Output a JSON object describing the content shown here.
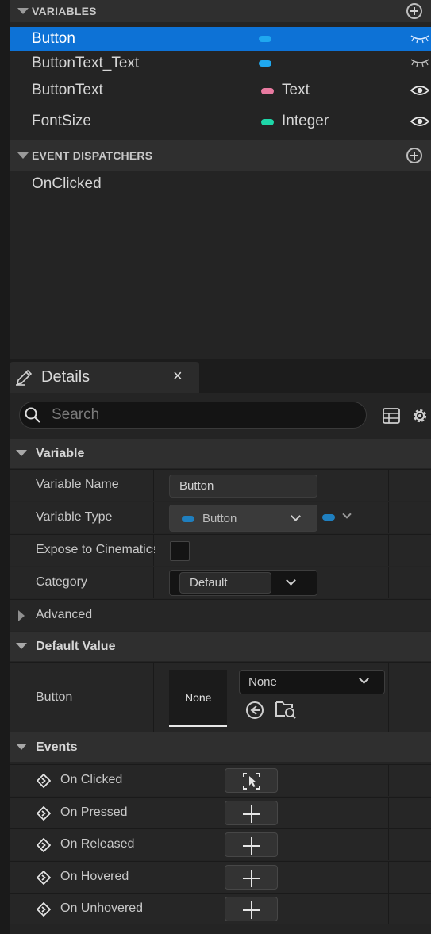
{
  "my_blueprint": {
    "variables_header": "VARIABLES",
    "variables": [
      {
        "name": "Button",
        "type": "",
        "color": "#1fa8f0",
        "selected": true
      },
      {
        "name": "ButtonText_Text",
        "type": "",
        "color": "#1fa8f0",
        "selected": false
      },
      {
        "name": "ButtonText",
        "type": "Text",
        "color": "#e87aa0",
        "selected": false
      },
      {
        "name": "FontSize",
        "type": "Integer",
        "color": "#1ed6a8",
        "selected": false
      }
    ],
    "dispatchers_header": "EVENT DISPATCHERS",
    "dispatchers": [
      {
        "name": "OnClicked"
      }
    ]
  },
  "details": {
    "tab_title": "Details",
    "close_glyph": "×",
    "search_placeholder": "Search",
    "variable_section": {
      "label": "Variable",
      "name_label": "Variable Name",
      "name_value": "Button",
      "type_label": "Variable Type",
      "type_value": "Button",
      "type_color": "#1f7fbf",
      "expose_label": "Expose to Cinematics",
      "category_label": "Category",
      "category_value": "Default",
      "advanced_label": "Advanced"
    },
    "default_value_section": {
      "label": "Default Value",
      "prop_label": "Button",
      "thumbnail_text": "None",
      "asset_value": "None"
    },
    "events_section": {
      "label": "Events",
      "events": [
        "On Clicked",
        "On Pressed",
        "On Released",
        "On Hovered",
        "On Unhovered"
      ]
    }
  },
  "icons": {
    "add_variable": "plus-circle-icon",
    "visibility": "eye-icon",
    "hidden": "eye-closed-icon",
    "search": "search-icon",
    "table_view": "table-icon",
    "settings": "gear-icon",
    "browse": "arrow-left-circle-icon",
    "find_in_browser": "folder-search-icon",
    "event_node": "diamond-arrow-icon"
  }
}
